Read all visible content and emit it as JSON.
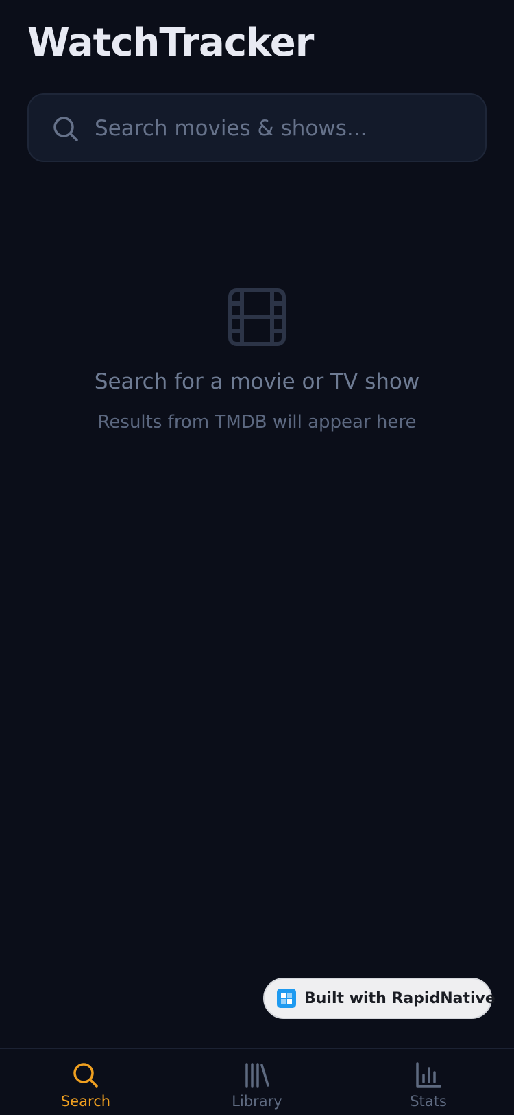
{
  "header": {
    "title": "WatchTracker"
  },
  "search": {
    "placeholder": "Search movies & shows...",
    "value": "",
    "icon": "search-icon"
  },
  "empty_state": {
    "icon": "film-icon",
    "title": "Search for a movie or TV show",
    "subtitle": "Results from TMDB will appear here"
  },
  "badge": {
    "label": "Built with RapidNative",
    "icon": "rapidnative-logo-icon"
  },
  "tabs": [
    {
      "label": "Search",
      "icon": "search-icon",
      "active": true
    },
    {
      "label": "Library",
      "icon": "library-icon",
      "active": false
    },
    {
      "label": "Stats",
      "icon": "bar-chart-icon",
      "active": false
    }
  ],
  "colors": {
    "background": "#0b0e19",
    "accent": "#f0a020",
    "inactive": "#5e6a80",
    "search_background": "#131a2a"
  }
}
